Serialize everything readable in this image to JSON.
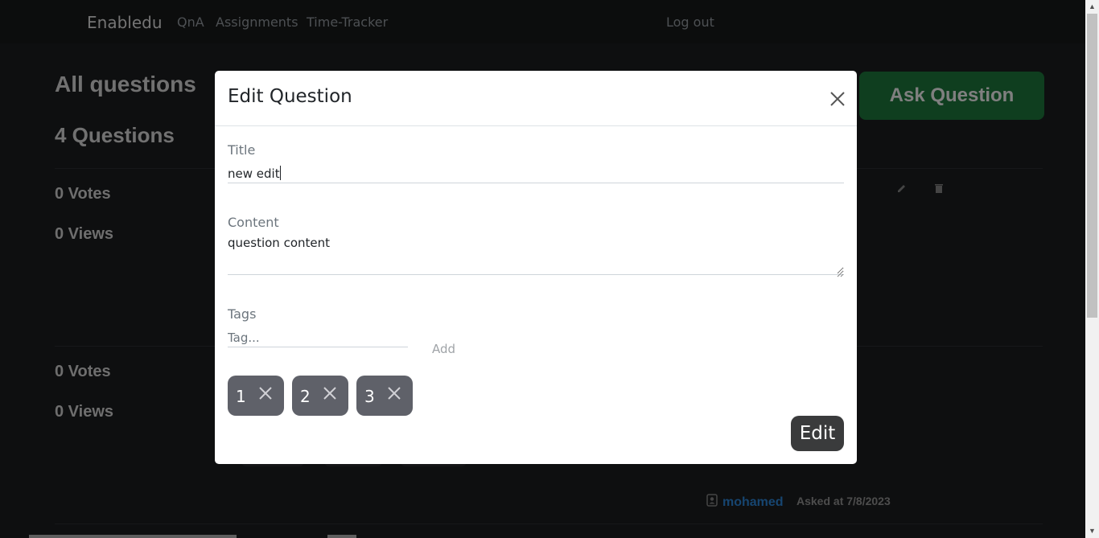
{
  "navbar": {
    "brand": "Enabledu",
    "links": [
      "QnA",
      "Assignments",
      "Time-Tracker"
    ],
    "logout": "Log out"
  },
  "page": {
    "title": "All questions",
    "count": "4 Questions",
    "ask_button": "Ask Question",
    "questions": [
      {
        "votes": "0 Votes",
        "views": "0 Views"
      },
      {
        "votes": "0 Votes",
        "views": "0 Views"
      }
    ],
    "author": "mohamed",
    "asked": "Asked at 7/8/2023"
  },
  "modal": {
    "title": "Edit Question",
    "title_label": "Title",
    "title_value": "new edit",
    "content_label": "Content",
    "content_value": "question content",
    "tags_label": "Tags",
    "tag_placeholder": "Tag...",
    "add_label": "Add",
    "tags": [
      "1",
      "2",
      "3"
    ],
    "submit_label": "Edit"
  },
  "icons": {
    "close": "close-icon",
    "tag_remove": "close-icon",
    "edit": "pencil-icon",
    "delete": "trash-icon",
    "author": "person-badge-icon"
  }
}
